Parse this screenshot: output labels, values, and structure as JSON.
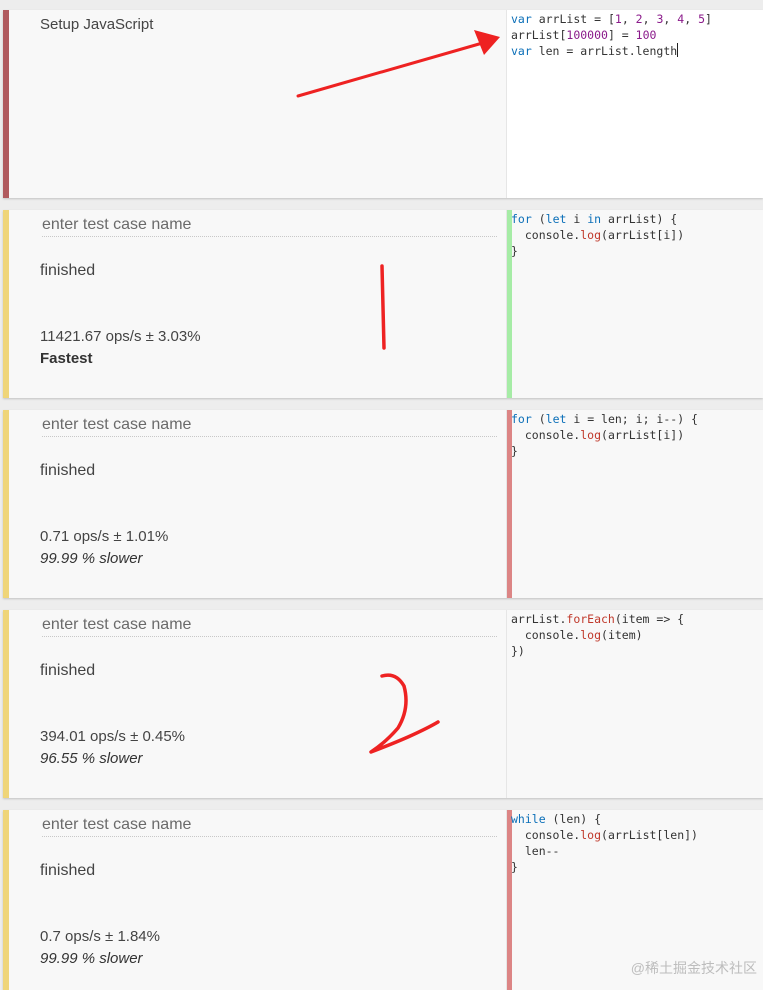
{
  "setup": {
    "title": "Setup JavaScript",
    "code_lines": [
      "var arrList = [1, 2, 3, 4, 5]",
      "arrList[100000] = 100",
      "var len = arrList.length"
    ]
  },
  "test_cases": [
    {
      "placeholder": "enter test case name",
      "status": "finished",
      "ops": "11421.67 ops/s ± 3.03%",
      "rank": "Fastest",
      "code_lines": [
        "for (let i in arrList) {",
        "  console.log(arrList[i])",
        "}"
      ]
    },
    {
      "placeholder": "enter test case name",
      "status": "finished",
      "ops": "0.71 ops/s ± 1.01%",
      "rank": "99.99 % slower",
      "code_lines": [
        "for (let i = len; i; i--) {",
        "  console.log(arrList[i])",
        "}"
      ]
    },
    {
      "placeholder": "enter test case name",
      "status": "finished",
      "ops": "394.01 ops/s ± 0.45%",
      "rank": "96.55 % slower",
      "code_lines": [
        "arrList.forEach(item => {",
        "  console.log(item)",
        "})"
      ]
    },
    {
      "placeholder": "enter test case name",
      "status": "finished",
      "ops": "0.7 ops/s ± 1.84%",
      "rank": "99.99 % slower",
      "code_lines": [
        "while (len) {",
        "  console.log(arrList[len])",
        "  len--",
        "}"
      ]
    }
  ],
  "colors": {
    "setup_bar": "#b05a5e",
    "case_bar": "#efd57a",
    "fastest_code_bar": "#a6eca6",
    "slower_code_bar": "#dc8585",
    "annotation": "#ee2222"
  },
  "watermark": "@稀土掘金技术社区"
}
